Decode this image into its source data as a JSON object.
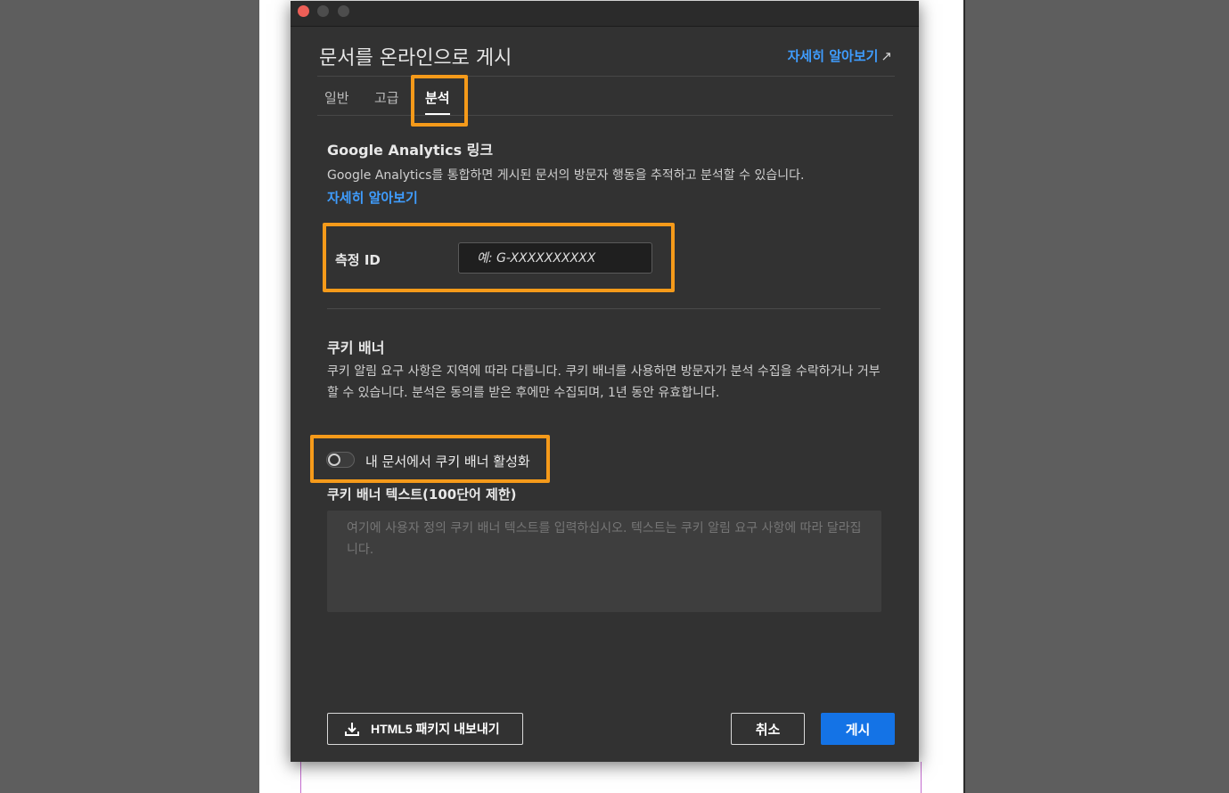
{
  "colors": {
    "accent": "#1473e6",
    "link": "#3f9dff",
    "highlight": "#f59a1a",
    "dialog_bg": "#323232",
    "workspace_bg": "#5e5e5e"
  },
  "window": {
    "controls": [
      "close",
      "minimize",
      "maximize"
    ]
  },
  "dialog": {
    "title": "문서를 온라인으로 게시",
    "learn_more": "자세히 알아보기",
    "learn_more_icon": "external-link-arrow-icon"
  },
  "tabs": [
    {
      "label": "일반",
      "active": false
    },
    {
      "label": "고급",
      "active": false
    },
    {
      "label": "분석",
      "active": true
    }
  ],
  "analytics": {
    "heading": "Google Analytics 링크",
    "description": "Google Analytics를 통합하면 게시된 문서의 방문자 행동을 추적하고 분석할 수 있습니다.",
    "learn_more": "자세히 알아보기",
    "measurement_label": "측정 ID",
    "measurement_placeholder": "예: G-XXXXXXXXXX",
    "measurement_value": ""
  },
  "cookie": {
    "heading": "쿠키 배너",
    "description": "쿠키 알림 요구 사항은 지역에 따라 다릅니다. 쿠키 배너를 사용하면 방문자가 분석 수집을 수락하거나 거부할 수 있습니다. 분석은 동의를 받은 후에만 수집되며, 1년 동안 유효합니다.",
    "toggle_label": "내 문서에서 쿠키 배너 활성화",
    "toggle_on": false,
    "banner_text_label": "쿠키 배너 텍스트(100단어 제한)",
    "banner_text_placeholder": "여기에 사용자 정의 쿠키 배너 텍스트를 입력하십시오. 텍스트는 쿠키 알림 요구 사항에 따라 달라집니다."
  },
  "footer": {
    "export_label": "HTML5 패키지 내보내기",
    "export_icon": "download-icon",
    "cancel_label": "취소",
    "publish_label": "게시"
  }
}
